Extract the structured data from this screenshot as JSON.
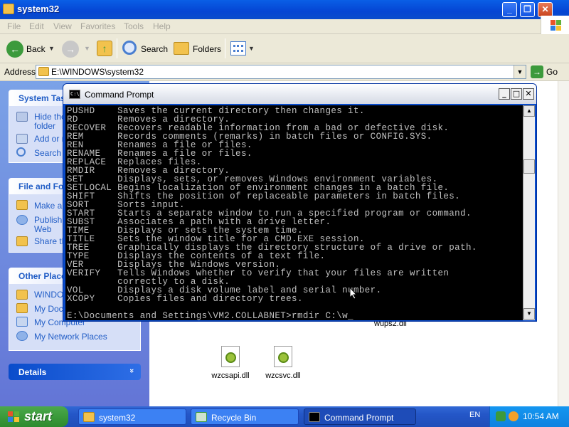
{
  "explorer": {
    "title": "system32",
    "caption_buttons": {
      "minimize": "_",
      "restore": "❐",
      "close": "✕"
    },
    "menu": [
      "File",
      "Edit",
      "View",
      "Favorites",
      "Tools",
      "Help"
    ],
    "toolbar": {
      "back_label": "Back",
      "search_label": "Search",
      "folders_label": "Folders"
    },
    "address": {
      "label": "Address",
      "value": "E:\\WINDOWS\\system32",
      "go_label": "Go"
    }
  },
  "taskpane": {
    "system_tasks": {
      "title": "System Tas",
      "items": [
        "Hide the",
        "folder",
        "Add or r",
        "Search f"
      ]
    },
    "file_folder_tasks": {
      "title": "File and Fo",
      "items": [
        "Make a n",
        "Publish t",
        "Web",
        "Share th"
      ]
    },
    "other_places": {
      "title": "Other Place",
      "items": [
        "WINDOW",
        "My Docu",
        "My Computer",
        "My Network Places"
      ]
    },
    "details": {
      "title": "Details",
      "chevron": "»"
    }
  },
  "files": {
    "partial_label": "wups2.dll",
    "items": [
      {
        "name": "wzcsapi.dll"
      },
      {
        "name": "wzcsvc.dll"
      }
    ]
  },
  "cmd": {
    "title": "Command Prompt",
    "icon_text": "C:\\",
    "buttons": {
      "minimize": "_",
      "maximize": "□",
      "close": "✕"
    },
    "lines": [
      "PUSHD    Saves the current directory then changes it.",
      "RD       Removes a directory.",
      "RECOVER  Recovers readable information from a bad or defective disk.",
      "REM      Records comments (remarks) in batch files or CONFIG.SYS.",
      "REN      Renames a file or files.",
      "RENAME   Renames a file or files.",
      "REPLACE  Replaces files.",
      "RMDIR    Removes a directory.",
      "SET      Displays, sets, or removes Windows environment variables.",
      "SETLOCAL Begins localization of environment changes in a batch file.",
      "SHIFT    Shifts the position of replaceable parameters in batch files.",
      "SORT     Sorts input.",
      "START    Starts a separate window to run a specified program or command.",
      "SUBST    Associates a path with a drive letter.",
      "TIME     Displays or sets the system time.",
      "TITLE    Sets the window title for a CMD.EXE session.",
      "TREE     Graphically displays the directory structure of a drive or path.",
      "TYPE     Displays the contents of a text file.",
      "VER      Displays the Windows version.",
      "VERIFY   Tells Windows whether to verify that your files are written",
      "         correctly to a disk.",
      "VOL      Displays a disk volume label and serial number.",
      "XCOPY    Copies files and directory trees.",
      "",
      "E:\\Documents and Settings\\VM2.COLLABNET>rmdir C:\\w_"
    ]
  },
  "taskbar": {
    "start_label": "start",
    "buttons": [
      "system32",
      "Recycle Bin",
      "Command Prompt"
    ],
    "language": "EN",
    "clock": "10:54 AM"
  }
}
